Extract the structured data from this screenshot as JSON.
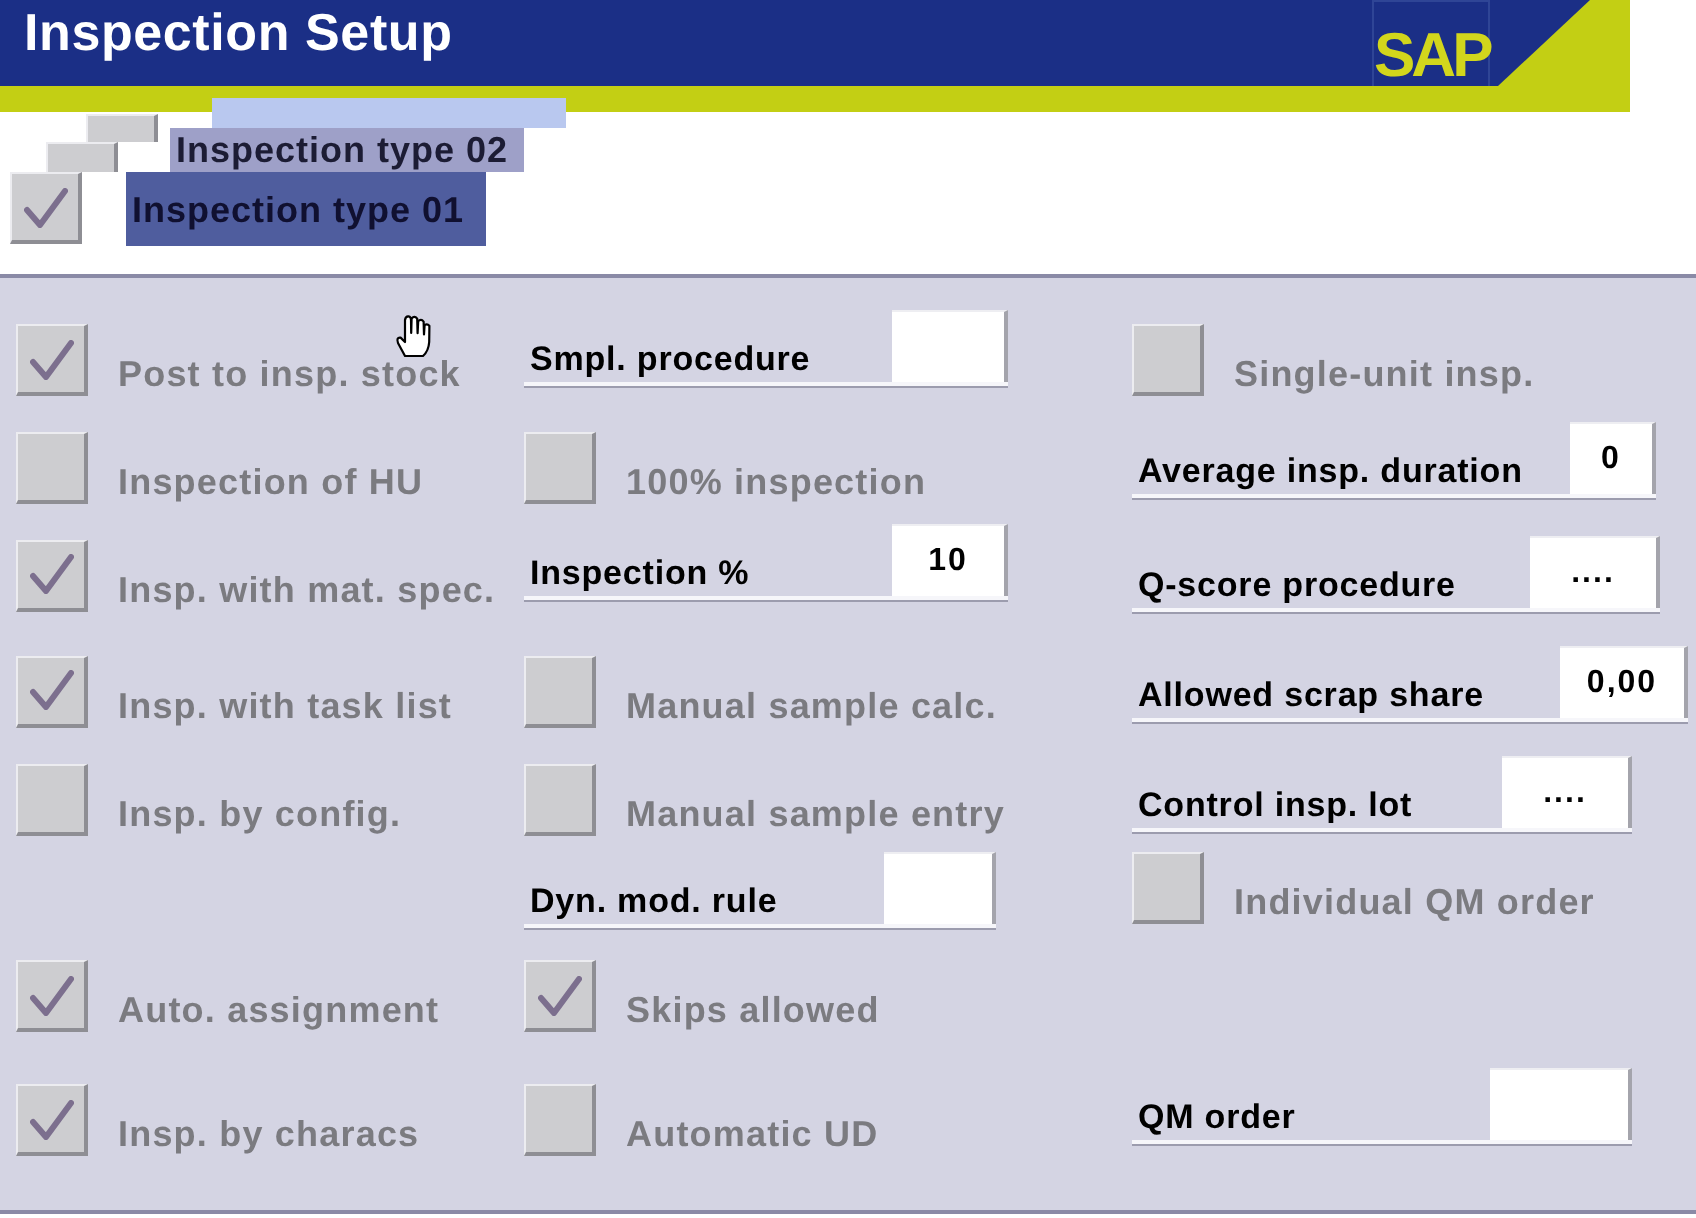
{
  "window": {
    "title": "Inspection Setup",
    "logo": "SAP"
  },
  "inspection_types": [
    {
      "checked": false,
      "selected": false
    },
    {
      "label": "Inspection type 02",
      "checked": false,
      "selected": false
    },
    {
      "label": "Inspection type 01",
      "checked": true,
      "selected": true
    }
  ],
  "columns": [
    {
      "items": [
        {
          "kind": "checkbox",
          "label": "Post to insp. stock",
          "checked": true,
          "disabled": true
        },
        {
          "kind": "checkbox",
          "label": "Inspection of HU",
          "checked": false,
          "disabled": true
        },
        {
          "kind": "checkbox",
          "label": "Insp. with mat. spec.",
          "checked": true,
          "disabled": true
        },
        {
          "kind": "checkbox",
          "label": "Insp. with task list",
          "checked": true,
          "disabled": true
        },
        {
          "kind": "checkbox",
          "label": "Insp. by config.",
          "checked": false,
          "disabled": true
        },
        {
          "kind": "checkbox",
          "label": "Auto. assignment",
          "checked": true,
          "disabled": true
        },
        {
          "kind": "checkbox",
          "label": "Insp. by characs",
          "checked": true,
          "disabled": true
        }
      ]
    },
    {
      "items": [
        {
          "kind": "field",
          "label": "Smpl. procedure"
        },
        {
          "kind": "checkbox",
          "label": "100% inspection",
          "checked": false,
          "disabled": true
        },
        {
          "kind": "field",
          "label": "Inspection %",
          "value": "10"
        },
        {
          "kind": "checkbox",
          "label": "Manual sample calc.",
          "checked": false,
          "disabled": true
        },
        {
          "kind": "checkbox",
          "label": "Manual sample entry",
          "checked": false,
          "disabled": true
        },
        {
          "kind": "field",
          "label": "Dyn. mod. rule"
        },
        {
          "kind": "checkbox",
          "label": "Skips allowed",
          "checked": true,
          "disabled": true
        },
        {
          "kind": "checkbox",
          "label": "Automatic UD",
          "checked": false,
          "disabled": true
        }
      ]
    },
    {
      "items": [
        {
          "kind": "checkbox",
          "label": "Single-unit insp.",
          "checked": false,
          "disabled": true
        },
        {
          "kind": "field",
          "label": "Average insp. duration",
          "value": "0"
        },
        {
          "kind": "field",
          "label": "Q-score procedure",
          "value": "...."
        },
        {
          "kind": "field",
          "label": "Allowed scrap share",
          "value": "0,00"
        },
        {
          "kind": "field",
          "label": "Control insp. lot",
          "value": "...."
        },
        {
          "kind": "checkbox",
          "label": "Individual QM order",
          "checked": false,
          "disabled": true
        },
        {
          "kind": "field",
          "label": "QM order"
        }
      ]
    }
  ]
}
